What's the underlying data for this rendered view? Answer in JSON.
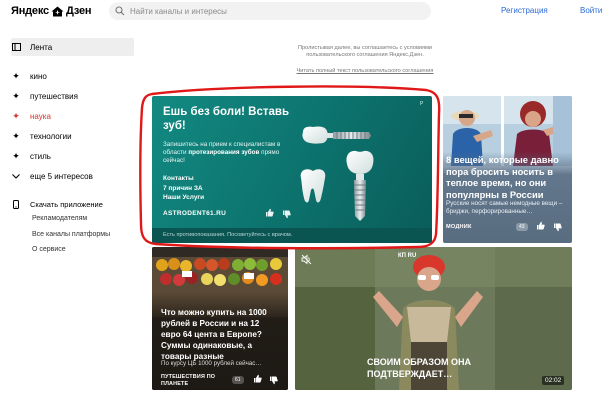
{
  "header": {
    "logo_left": "Яндекс",
    "logo_right": "Дзен",
    "search_placeholder": "Найти каналы и интересы",
    "register": "Регистрация",
    "login": "Войти"
  },
  "sidebar": {
    "items": [
      {
        "label": "Лента",
        "icon": "feed-icon"
      },
      {
        "label": "кино",
        "icon": "sparkle-icon"
      },
      {
        "label": "путешествия",
        "icon": "sparkle-icon"
      },
      {
        "label": "наука",
        "icon": "sparkle-icon"
      },
      {
        "label": "технологии",
        "icon": "sparkle-icon"
      },
      {
        "label": "стиль",
        "icon": "sparkle-icon"
      },
      {
        "label": "еще 5 интересов",
        "icon": "chevron-down-icon"
      }
    ],
    "download_app": "Скачать приложение",
    "links": [
      "Рекламодателям",
      "Все каналы платформы",
      "О сервисе"
    ]
  },
  "agreement": {
    "text": "Пролистывая далее, вы соглашаетесь с условиями пользовательского соглашения Яндекс.Дзен.",
    "link": "Читать полный текст пользовательского соглашения"
  },
  "ad_card": {
    "title": "Ешь без боли! Вставь зуб!",
    "desc_before": "Запишитесь на прием к специалистам в области ",
    "desc_bold": "протезирования зубов",
    "desc_after": " прямо сейчас!",
    "contacts": [
      "Контакты",
      "7 причин ЗА",
      "Наши Услуги"
    ],
    "domain": "ASTRODENT61.RU",
    "flag": "P",
    "footer": "Есть противопоказания. Посоветуйтесь с врачом.",
    "accent": "#0f7d77"
  },
  "right_card": {
    "title": "8 вещей, которые давно пора бросить носить в теплое время, но они популярны в России",
    "subtitle": "Русские носят самые немодные вещи – бриджи, перфорированные…",
    "source": "МОДНИК",
    "count": "43"
  },
  "bottom_card_1": {
    "title": "Что можно купить на 1000 рублей в России и на 12 евро 64 цента в Европе? Суммы одинаковые, а товары разные",
    "subtitle": "По курсу ЦБ 1000 рублей сейчас…",
    "source": "ПУТЕШЕСТВИЯ ПО ПЛАНЕТЕ",
    "count": "61"
  },
  "video_card": {
    "brand": "КП RU",
    "caption": "СВОИМ ОБРАЗОМ ОНА ПОДТВЕРЖДАЕТ…",
    "duration": "02:02"
  },
  "annotation": {
    "color": "#e01818"
  }
}
